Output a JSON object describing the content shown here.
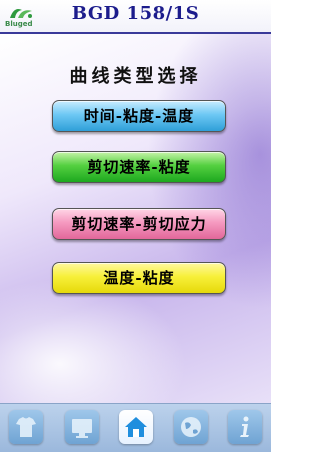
{
  "header": {
    "logo_text": "Bluged",
    "title": "BGD  158/1S"
  },
  "main": {
    "heading": "曲线类型选择",
    "buttons": [
      {
        "label": "时间-粘度-温度",
        "color": "#4fb7ea"
      },
      {
        "label": "剪切速率-粘度",
        "color": "#37c232"
      },
      {
        "label": "剪切速率-剪切应力",
        "color": "#ee86b4"
      },
      {
        "label": "温度-粘度",
        "color": "#f3ec2a"
      }
    ]
  },
  "footer": {
    "icons": [
      {
        "icon": "shirt-icon"
      },
      {
        "icon": "monitor-icon"
      },
      {
        "icon": "home-icon",
        "active": true
      },
      {
        "icon": "globe-icon"
      },
      {
        "icon": "info-icon"
      }
    ]
  },
  "colors": {
    "header_text": "#1c1c8c",
    "header_border": "#3a3a9a",
    "footer_bg": "#a9c4e4"
  }
}
